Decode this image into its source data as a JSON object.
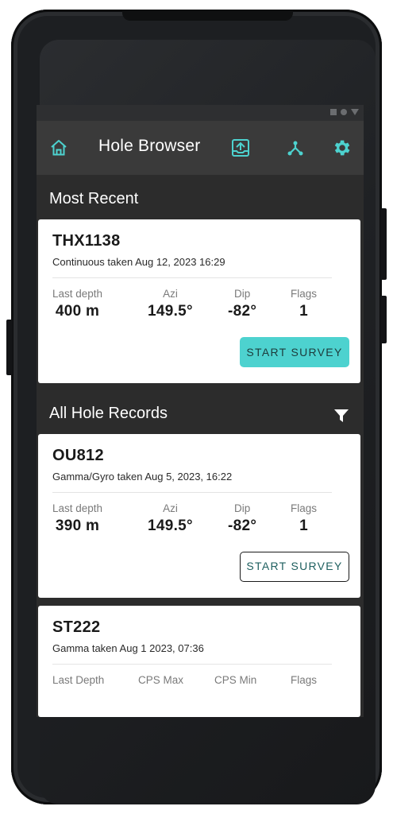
{
  "colors": {
    "accent": "#4dd2cf",
    "appbar": "#3a3a3a",
    "background": "#2c2c2c",
    "card": "#ffffff"
  },
  "appbar": {
    "title": "Hole Browser",
    "icons": [
      "home-icon",
      "upload-icon",
      "network-icon",
      "settings-icon"
    ]
  },
  "most_recent": {
    "title": "Most Recent",
    "card": {
      "name": "THX1138",
      "subtitle": "Continuous taken Aug 12, 2023 16:29",
      "stats": [
        {
          "label": "Last depth",
          "value": "400 m"
        },
        {
          "label": "Azi",
          "value": "149.5°"
        },
        {
          "label": "Dip",
          "value": "-82°"
        },
        {
          "label": "Flags",
          "value": "1"
        }
      ],
      "button": "START SURVEY"
    }
  },
  "all_records": {
    "title": "All Hole Records",
    "cards": [
      {
        "name": "OU812",
        "subtitle": "Gamma/Gyro taken Aug 5, 2023, 16:22",
        "stats": [
          {
            "label": "Last depth",
            "value": "390 m"
          },
          {
            "label": "Azi",
            "value": "149.5°"
          },
          {
            "label": "Dip",
            "value": "-82°"
          },
          {
            "label": "Flags",
            "value": "1"
          }
        ],
        "button": "START SURVEY"
      },
      {
        "name": "ST222",
        "subtitle": "Gamma taken Aug 1 2023, 07:36",
        "stats": [
          {
            "label": "Last Depth"
          },
          {
            "label": "CPS Max"
          },
          {
            "label": "CPS Min"
          },
          {
            "label": "Flags"
          }
        ]
      }
    ]
  }
}
